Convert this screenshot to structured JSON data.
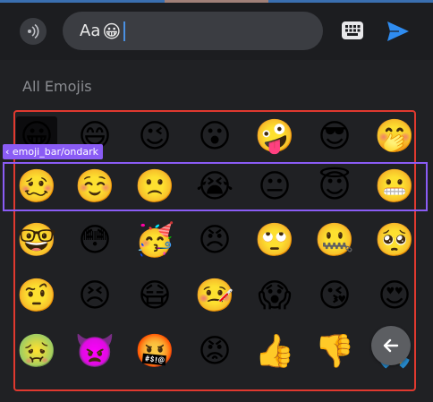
{
  "composer": {
    "input_text": "Aa",
    "input_emoji": "😀"
  },
  "panel": {
    "section_title": "All Emojis",
    "debug_tag": "emoji_bar/ondark",
    "rows": [
      [
        "😀",
        "😄",
        "😉",
        "😮",
        "🤪",
        "😎",
        "🤭"
      ],
      [
        "🥴",
        "☺️",
        "🙁",
        "😭",
        "😐",
        "😇",
        "😬"
      ],
      [
        "🤓",
        "😳",
        "🥳",
        "😠",
        "🙄",
        "🤐",
        "🥺"
      ],
      [
        "🤨",
        "😣",
        "😷",
        "🤒",
        "😱",
        "😘",
        "😍"
      ],
      [
        "🤢",
        "👿",
        "🤬",
        "😡",
        "👍",
        "👎",
        "🙏"
      ]
    ]
  },
  "colors": {
    "accent_blue": "#2f8cf0",
    "highlight_red": "#e0392f",
    "highlight_purple": "#8a5cf5"
  }
}
